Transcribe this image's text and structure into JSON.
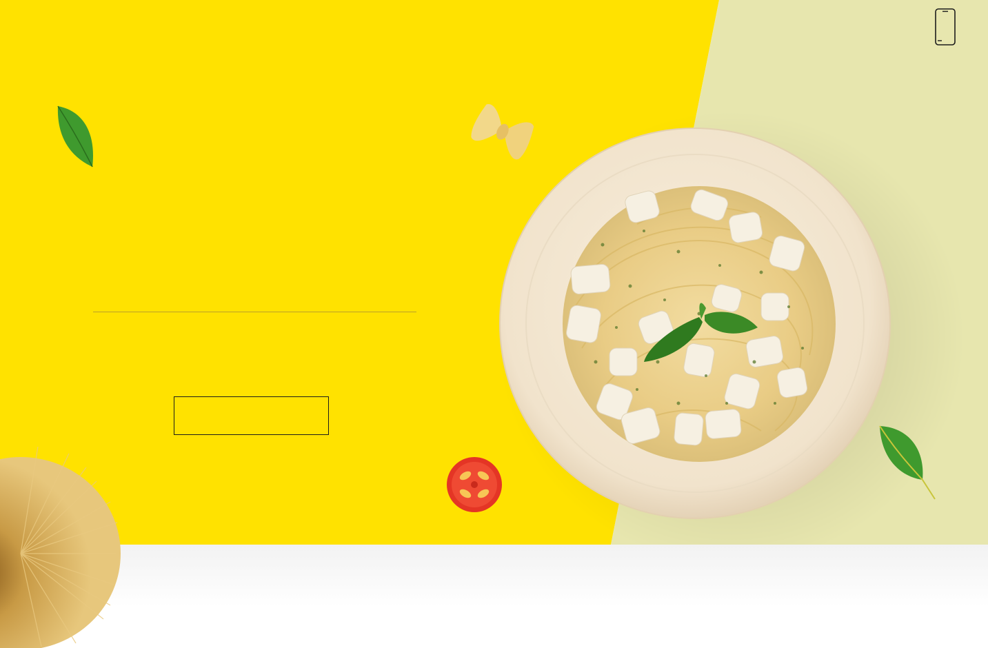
{
  "colors": {
    "yellow": "#ffe200",
    "sage": "#e7e6ae",
    "plate": "#f3e6d2",
    "divider": "#b99f2a",
    "button_border": "#1b1b1b"
  },
  "header": {
    "contact_icon": "smartphone-icon"
  },
  "hero": {
    "decorations": [
      "basil-leaf",
      "farfalle-pasta",
      "cherry-tomato",
      "spaghetti-bundle",
      "basil-leaf"
    ],
    "dish": "spaghetti-chicken-plate",
    "cta_label": ""
  }
}
